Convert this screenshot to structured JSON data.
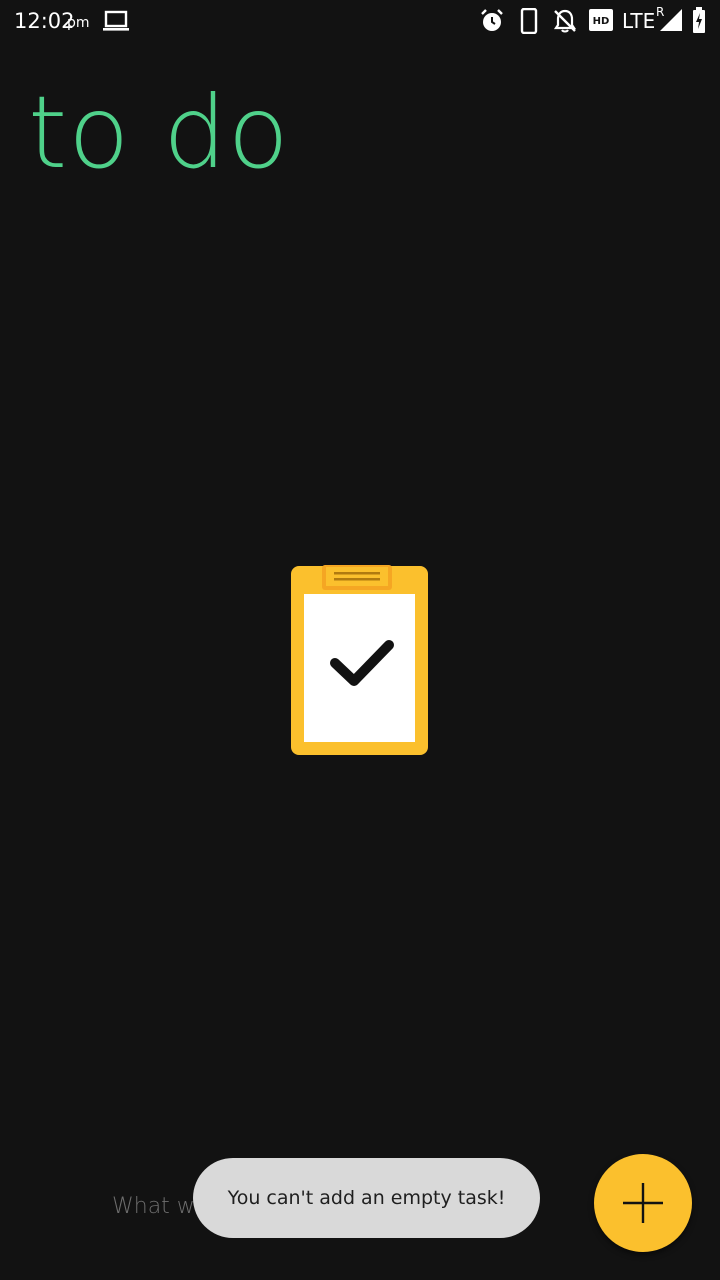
{
  "status_bar": {
    "time": "12:02",
    "ampm": "pm",
    "network": "LTE",
    "roaming": "R",
    "icons": [
      "laptop-icon",
      "alarm-icon",
      "phone-icon",
      "bell-off-icon",
      "hd-icon",
      "signal-icon",
      "battery-charging-icon"
    ]
  },
  "app": {
    "title": "to do"
  },
  "empty_state": {
    "icon": "clipboard-check-icon"
  },
  "input": {
    "placeholder": "What would you like to do?"
  },
  "toast": {
    "message": "You can't add an empty task!"
  },
  "fab": {
    "icon": "plus-icon"
  },
  "colors": {
    "background": "#121212",
    "title": "#4fd18a",
    "accent": "#fbc02d",
    "toast_bg": "#d9d9d9"
  }
}
